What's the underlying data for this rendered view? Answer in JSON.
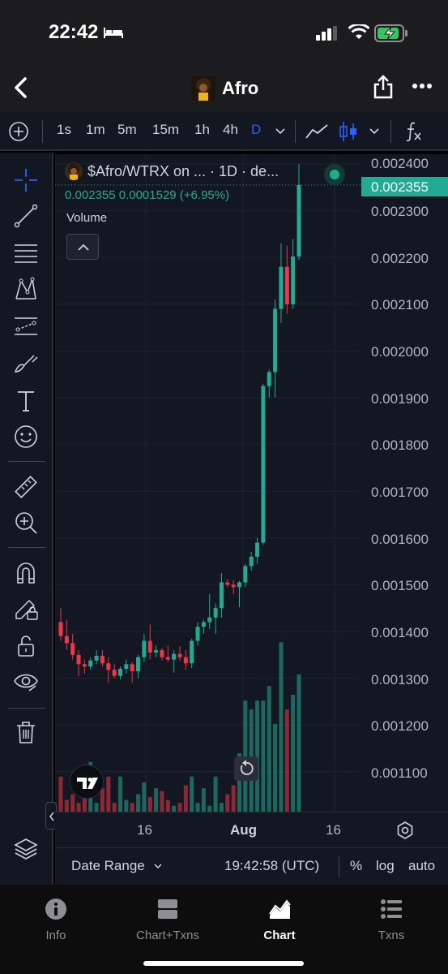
{
  "status_bar": {
    "time": "22:42"
  },
  "header": {
    "title": "Afro"
  },
  "toolbar": {
    "intervals": [
      "1s",
      "1m",
      "5m",
      "15m",
      "1h",
      "4h",
      "D"
    ],
    "active_interval": "D",
    "fx_label": "fx"
  },
  "legend": {
    "symbol": "$Afro/WTRX on ... · 1D · de...",
    "values": "0.002355  0.0001529 (+6.95%)",
    "volume_label": "Volume"
  },
  "price_axis": {
    "labels": [
      "0.002400",
      "0.002300",
      "0.002200",
      "0.002100",
      "0.002000",
      "0.001900",
      "0.001800",
      "0.001700",
      "0.001600",
      "0.001500",
      "0.001400",
      "0.001300",
      "0.001200",
      "0.001100"
    ],
    "current_price": "0.002355"
  },
  "time_axis": {
    "labels": [
      "16",
      "Aug",
      "16"
    ]
  },
  "chart_bottom": {
    "date_range": "Date Range",
    "clock": "19:42:58 (UTC)",
    "percent": "%",
    "log": "log",
    "auto": "auto"
  },
  "tabs": [
    {
      "label": "Info",
      "icon": "info-icon"
    },
    {
      "label": "Chart+Txns",
      "icon": "split-view-icon"
    },
    {
      "label": "Chart",
      "icon": "chart-icon"
    },
    {
      "label": "Txns",
      "icon": "list-icon"
    }
  ],
  "active_tab": "Chart",
  "colors": {
    "up": "#22ab94",
    "down": "#f23645",
    "accent": "#2962ff",
    "background": "#131722"
  },
  "chart_data": {
    "type": "candlestick",
    "title": "$Afro/WTRX on ... · 1D · de...",
    "ylim": [
      0.00105,
      0.0024
    ],
    "candles": [
      {
        "o": 0.00142,
        "h": 0.00145,
        "l": 0.00138,
        "c": 0.00139
      },
      {
        "o": 0.00139,
        "h": 0.001425,
        "l": 0.00136,
        "c": 0.001375
      },
      {
        "o": 0.001375,
        "h": 0.001395,
        "l": 0.00134,
        "c": 0.00135
      },
      {
        "o": 0.00135,
        "h": 0.00136,
        "l": 0.001305,
        "c": 0.00133
      },
      {
        "o": 0.00133,
        "h": 0.00134,
        "l": 0.00131,
        "c": 0.001325
      },
      {
        "o": 0.001325,
        "h": 0.001345,
        "l": 0.001318,
        "c": 0.001338
      },
      {
        "o": 0.001338,
        "h": 0.00136,
        "l": 0.00133,
        "c": 0.001348
      },
      {
        "o": 0.001348,
        "h": 0.00136,
        "l": 0.001325,
        "c": 0.001332
      },
      {
        "o": 0.001332,
        "h": 0.001345,
        "l": 0.00129,
        "c": 0.001318
      },
      {
        "o": 0.001318,
        "h": 0.00133,
        "l": 0.0013,
        "c": 0.001305
      },
      {
        "o": 0.001305,
        "h": 0.001325,
        "l": 0.001298,
        "c": 0.00132
      },
      {
        "o": 0.00132,
        "h": 0.00134,
        "l": 0.00131,
        "c": 0.00133
      },
      {
        "o": 0.00133,
        "h": 0.001335,
        "l": 0.00129,
        "c": 0.001315
      },
      {
        "o": 0.001315,
        "h": 0.00135,
        "l": 0.0013,
        "c": 0.001345
      },
      {
        "o": 0.001345,
        "h": 0.001395,
        "l": 0.001335,
        "c": 0.00138
      },
      {
        "o": 0.00138,
        "h": 0.001415,
        "l": 0.00134,
        "c": 0.001355
      },
      {
        "o": 0.001355,
        "h": 0.00137,
        "l": 0.001345,
        "c": 0.00136
      },
      {
        "o": 0.00136,
        "h": 0.001365,
        "l": 0.001338,
        "c": 0.001345
      },
      {
        "o": 0.001345,
        "h": 0.00137,
        "l": 0.001335,
        "c": 0.00134
      },
      {
        "o": 0.00134,
        "h": 0.00136,
        "l": 0.001312,
        "c": 0.001352
      },
      {
        "o": 0.001352,
        "h": 0.001368,
        "l": 0.001338,
        "c": 0.001345
      },
      {
        "o": 0.001345,
        "h": 0.00136,
        "l": 0.001318,
        "c": 0.001332
      },
      {
        "o": 0.001332,
        "h": 0.001385,
        "l": 0.001322,
        "c": 0.00138
      },
      {
        "o": 0.00138,
        "h": 0.00142,
        "l": 0.00137,
        "c": 0.00141
      },
      {
        "o": 0.00141,
        "h": 0.001425,
        "l": 0.001395,
        "c": 0.00142
      },
      {
        "o": 0.00142,
        "h": 0.00148,
        "l": 0.001405,
        "c": 0.00143
      },
      {
        "o": 0.00143,
        "h": 0.00146,
        "l": 0.001395,
        "c": 0.00145
      },
      {
        "o": 0.00145,
        "h": 0.001525,
        "l": 0.00143,
        "c": 0.001505
      },
      {
        "o": 0.001505,
        "h": 0.001512,
        "l": 0.001495,
        "c": 0.0015
      },
      {
        "o": 0.0015,
        "h": 0.00151,
        "l": 0.00148,
        "c": 0.001495
      },
      {
        "o": 0.001495,
        "h": 0.001508,
        "l": 0.001452,
        "c": 0.001505
      },
      {
        "o": 0.001505,
        "h": 0.001545,
        "l": 0.001495,
        "c": 0.00154
      },
      {
        "o": 0.00154,
        "h": 0.00157,
        "l": 0.00153,
        "c": 0.00156
      },
      {
        "o": 0.00156,
        "h": 0.0016,
        "l": 0.001545,
        "c": 0.00159
      },
      {
        "o": 0.00159,
        "h": 0.00193,
        "l": 0.001585,
        "c": 0.001925
      },
      {
        "o": 0.001925,
        "h": 0.00196,
        "l": 0.0019,
        "c": 0.001955
      },
      {
        "o": 0.001955,
        "h": 0.00211,
        "l": 0.0019,
        "c": 0.00209
      },
      {
        "o": 0.00209,
        "h": 0.00223,
        "l": 0.00206,
        "c": 0.00218
      },
      {
        "o": 0.00218,
        "h": 0.002225,
        "l": 0.00208,
        "c": 0.0021
      },
      {
        "o": 0.0021,
        "h": 0.00224,
        "l": 0.00209,
        "c": 0.002202
      },
      {
        "o": 0.002202,
        "h": 0.0024,
        "l": 0.002195,
        "c": 0.002355
      }
    ],
    "volumes": [
      12,
      4,
      6,
      3,
      8,
      17,
      3,
      8,
      12,
      3,
      12,
      4,
      3,
      6,
      10,
      5,
      8,
      7,
      4,
      2,
      3,
      9,
      12,
      3,
      8,
      2,
      12,
      3,
      6,
      9,
      20,
      38,
      35,
      38,
      38,
      43,
      30,
      58,
      35,
      40,
      47
    ]
  }
}
